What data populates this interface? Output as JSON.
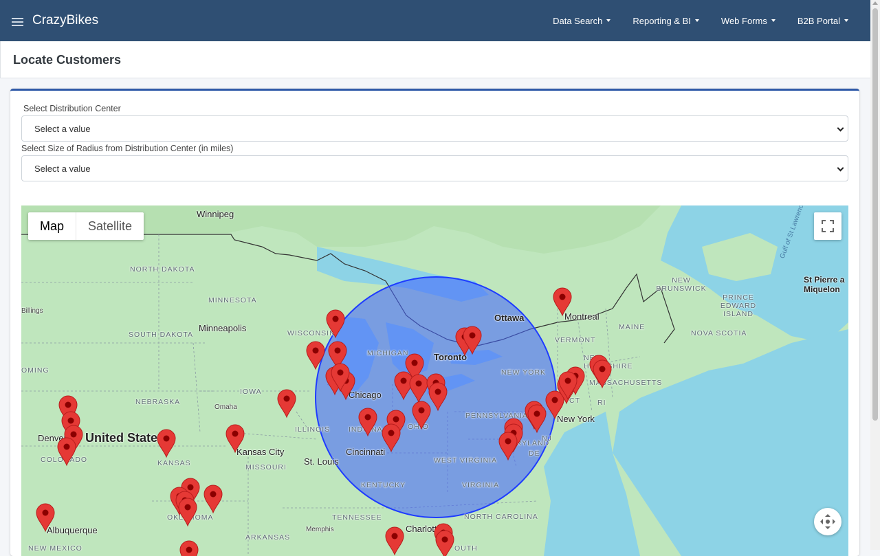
{
  "app": {
    "name": "CrazyBikes"
  },
  "nav": {
    "items": [
      {
        "label": "Data Search"
      },
      {
        "label": "Reporting & BI"
      },
      {
        "label": "Web Forms"
      },
      {
        "label": "B2B Portal"
      }
    ]
  },
  "page": {
    "title": "Locate Customers"
  },
  "form": {
    "distribution_center": {
      "label": "Select Distribution Center",
      "value": "Select a value"
    },
    "radius": {
      "label": "Select Size of Radius from Distribution Center (in miles)",
      "value": "Select a value"
    }
  },
  "map": {
    "type_buttons": {
      "map": "Map",
      "satellite": "Satellite",
      "active": "Map"
    },
    "radius_circle_color": "#4060ff",
    "marker_color": "#e53935",
    "labels": {
      "winnipeg": "Winnipeg",
      "north_dakota": "NORTH DAKOTA",
      "minnesota": "MINNESOTA",
      "south_dakota": "SOUTH DAKOTA",
      "billings": "Billings",
      "wyoming": "OMING",
      "minneapolis": "Minneapolis",
      "wisconsin": "WISCONSIN",
      "michigan": "MICHIGAN",
      "iowa": "IOWA",
      "nebraska": "NEBRASKA",
      "omaha": "Omaha",
      "chicago": "Chicago",
      "illinois": "ILLINOIS",
      "indiana": "INDIANA",
      "ohio": "OHIO",
      "denver": "Denver",
      "united_states": "United States",
      "colorado": "COLORADO",
      "kansas": "KANSAS",
      "kansas_city": "Kansas City",
      "missouri": "MISSOURI",
      "st_louis": "St. Louis",
      "cincinnati": "Cincinnati",
      "west_virginia": "WEST VIRGINIA",
      "kentucky": "KENTUCKY",
      "virginia": "VIRGINIA",
      "oklahoma": "OKLAHOMA",
      "tennessee": "TENNESSEE",
      "memphis": "Memphis",
      "arkansas": "ARKANSAS",
      "north_carolina": "NORTH CAROLINA",
      "charlotte": "Charlotte",
      "albuquerque": "Albuquerque",
      "new_mexico": "NEW MEXICO",
      "south": "OUTH",
      "ottawa": "Ottawa",
      "montreal": "Montreal",
      "toronto": "Toronto",
      "vermont": "VERMONT",
      "new_york_state": "NEW YORK",
      "new_hampshire": "NEW HAMPSHIRE",
      "massachusetts": "MASSACHUSETTS",
      "ct": "CT",
      "ri": "RI",
      "new_york": "New York",
      "pennsylvania": "PENNSYLVANIA",
      "nj": "NJ",
      "maryland": "MARYLAND",
      "de": "DE",
      "maine": "MAINE",
      "new_brunswick": "NEW BRUNSWICK",
      "prince_edward_island": "PRINCE EDWARD ISLAND",
      "nova_scotia": "NOVA SCOTIA",
      "st_pierre": "St Pierre a Miquelon",
      "gulf": "Gulf of St Lawrence"
    }
  }
}
